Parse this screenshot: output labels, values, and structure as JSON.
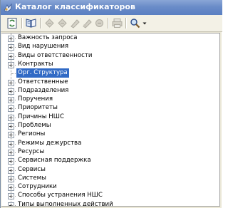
{
  "window": {
    "title": "Каталог классификаторов",
    "icon": "catalog-icon"
  },
  "toolbar": {
    "buttons": [
      {
        "name": "refresh-button",
        "icon": "refresh-icon",
        "enabled": true
      },
      {
        "name": "open-button",
        "icon": "book-icon",
        "enabled": true
      },
      {
        "name": "add-button",
        "icon": "add-icon",
        "enabled": false
      },
      {
        "name": "edit-button",
        "icon": "edit-icon",
        "enabled": false
      },
      {
        "name": "copy-button",
        "icon": "copy-icon",
        "enabled": false
      },
      {
        "name": "delete-button",
        "icon": "delete-icon",
        "enabled": false
      },
      {
        "name": "undo-button",
        "icon": "undo-icon",
        "enabled": false
      },
      {
        "name": "print-button",
        "icon": "printer-icon",
        "enabled": false
      },
      {
        "name": "search-button",
        "icon": "search-icon",
        "enabled": true
      },
      {
        "name": "search-dropdown",
        "icon": "chevron-down-icon",
        "enabled": true
      }
    ]
  },
  "tree": {
    "selected": "Орг. Структура",
    "items": [
      {
        "label": "Важность запроса",
        "expandable": true
      },
      {
        "label": "Вид нарушения",
        "expandable": true
      },
      {
        "label": "Виды ответственности",
        "expandable": true
      },
      {
        "label": "Контракты",
        "expandable": true
      },
      {
        "label": "Орг. Структура",
        "expandable": false,
        "selected": true
      },
      {
        "label": "Ответственные",
        "expandable": true
      },
      {
        "label": "Подразделения",
        "expandable": true
      },
      {
        "label": "Поручения",
        "expandable": true
      },
      {
        "label": "Приоритеты",
        "expandable": true
      },
      {
        "label": "Причины НШС",
        "expandable": true
      },
      {
        "label": "Проблемы",
        "expandable": true
      },
      {
        "label": "Регионы",
        "expandable": true
      },
      {
        "label": "Режимы дежурства",
        "expandable": true
      },
      {
        "label": "Ресурсы",
        "expandable": true
      },
      {
        "label": "Сервисная поддержка",
        "expandable": true
      },
      {
        "label": "Сервисы",
        "expandable": true
      },
      {
        "label": "Системы",
        "expandable": true
      },
      {
        "label": "Сотрудники",
        "expandable": true
      },
      {
        "label": "Способы устранения НШС",
        "expandable": true
      },
      {
        "label": "Типы выполненных действий",
        "expandable": true
      }
    ]
  },
  "colors": {
    "titlebar": "#6a8cc8",
    "selection": "#316ac5",
    "toolbar": "#f3f1e6"
  }
}
